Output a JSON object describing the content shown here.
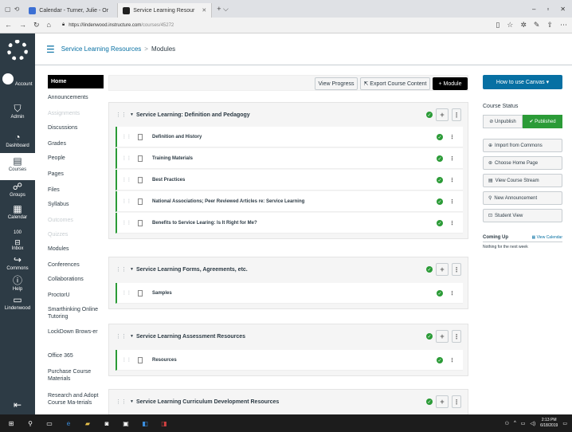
{
  "browser": {
    "tabs": [
      {
        "title": "Calendar - Turner, Julie - Or"
      },
      {
        "title": "Service Learning Resour"
      }
    ],
    "url_host": "https://lindenwood.instructure.com",
    "url_path": "/courses/45272"
  },
  "global_nav": {
    "items": [
      {
        "label": "Account",
        "icon": "avatar-icon"
      },
      {
        "label": "Admin",
        "icon": "shield-icon"
      },
      {
        "label": "Dashboard",
        "icon": "dashboard-icon"
      },
      {
        "label": "Courses",
        "icon": "book-icon"
      },
      {
        "label": "Groups",
        "icon": "groups-icon"
      },
      {
        "label": "Calendar",
        "icon": "calendar-icon"
      },
      {
        "label": "Inbox",
        "icon": "inbox-icon",
        "badge": "100"
      },
      {
        "label": "Commons",
        "icon": "commons-icon"
      },
      {
        "label": "Help",
        "icon": "help-icon"
      },
      {
        "label": "Lindenwood",
        "icon": "square-icon"
      }
    ]
  },
  "header": {
    "course": "Service Learning Resources",
    "separator": ">",
    "current": "Modules"
  },
  "course_nav": [
    {
      "label": "Home",
      "state": "active"
    },
    {
      "label": "Announcements",
      "state": "normal"
    },
    {
      "label": "Assignments",
      "state": "disabled"
    },
    {
      "label": "Discussions",
      "state": "normal"
    },
    {
      "label": "Grades",
      "state": "normal"
    },
    {
      "label": "People",
      "state": "normal"
    },
    {
      "label": "Pages",
      "state": "normal"
    },
    {
      "label": "Files",
      "state": "normal"
    },
    {
      "label": "Syllabus",
      "state": "normal"
    },
    {
      "label": "Outcomes",
      "state": "disabled"
    },
    {
      "label": "Quizzes",
      "state": "disabled"
    },
    {
      "label": "Modules",
      "state": "normal"
    },
    {
      "label": "Conferences",
      "state": "normal"
    },
    {
      "label": "Collaborations",
      "state": "normal"
    },
    {
      "label": "ProctorU",
      "state": "normal"
    },
    {
      "label": "Smarthinking Online Tutoring",
      "state": "normal"
    },
    {
      "label": "LockDown Brows-er",
      "state": "normal"
    },
    {
      "label": "Office 365",
      "state": "normal"
    },
    {
      "label": "Purchase Course Materials",
      "state": "normal"
    },
    {
      "label": "Research and Adopt Course Ma-terials",
      "state": "normal"
    }
  ],
  "toolbar": {
    "view_progress": "View Progress",
    "export": "Export Course Content",
    "add_module": "Module"
  },
  "modules": [
    {
      "title": "Service Learning: Definition and Pedagogy",
      "items": [
        "Definition and History",
        "Training Materials",
        "Best Practices",
        "National Associations; Peer Reviewed Articles re: Service Learning",
        "Benefits to Service Learing: Is It Right for Me?"
      ]
    },
    {
      "title": "Service Learning Forms, Agreements, etc.",
      "items": [
        "Samples"
      ]
    },
    {
      "title": "Service Learning Assessment Resources",
      "items": [
        "Resources"
      ]
    },
    {
      "title": "Service Learning Curriculum Development Resources",
      "items": []
    }
  ],
  "sidebar": {
    "how_to": "How to use Canvas ▾",
    "course_status": "Course Status",
    "unpublish": "Unpublish",
    "published": "Published",
    "buttons": [
      {
        "label": "Import from Commons",
        "icon": "import-icon"
      },
      {
        "label": "Choose Home Page",
        "icon": "home-icon"
      },
      {
        "label": "View Course Stream",
        "icon": "stream-icon"
      },
      {
        "label": "New Announcement",
        "icon": "announcement-icon"
      },
      {
        "label": "Student View",
        "icon": "student-icon"
      }
    ],
    "coming_up": "Coming Up",
    "view_calendar": "View Calendar",
    "nothing": "Nothing for the next week"
  },
  "taskbar": {
    "time": "2:13 PM",
    "date": "6/18/2019"
  },
  "colors": {
    "canvas_dark": "#2d3b45",
    "link_blue": "#0770a3",
    "published_green": "#2b9b37"
  }
}
